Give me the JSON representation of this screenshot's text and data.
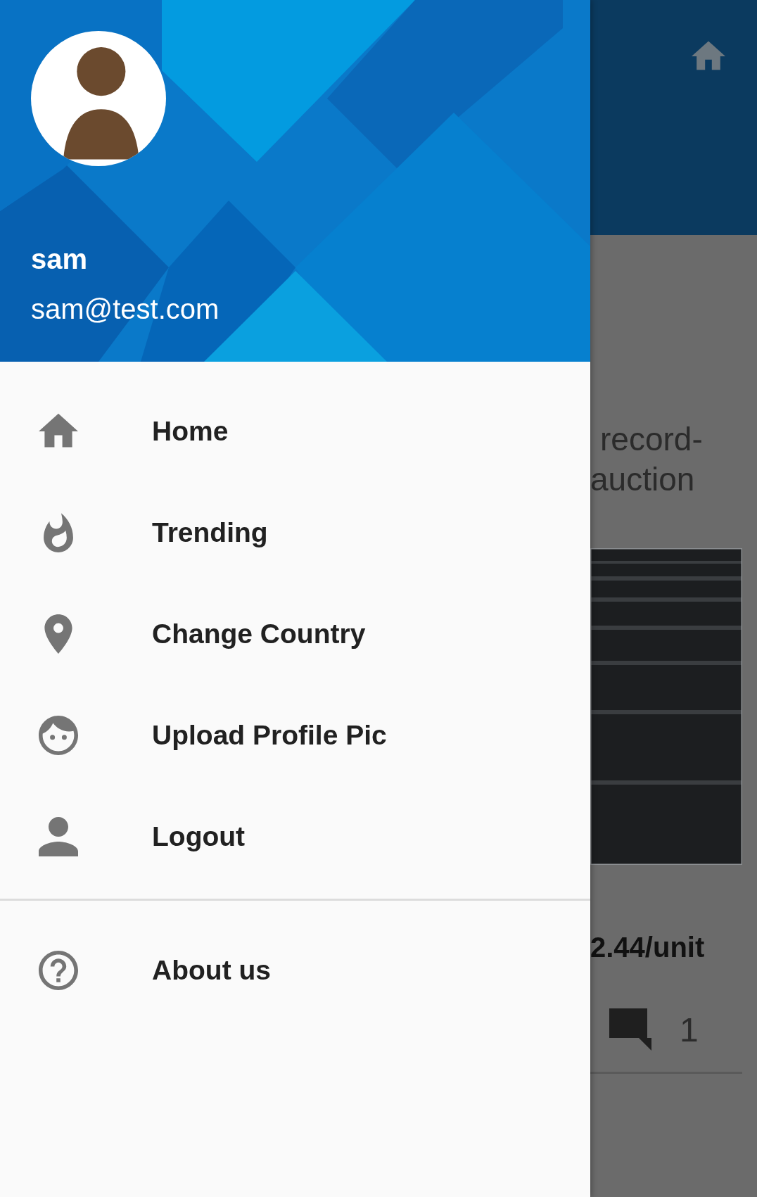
{
  "drawer": {
    "user": {
      "name": "sam",
      "email": "sam@test.com"
    },
    "menu": [
      {
        "label": "Home",
        "kind": "home"
      },
      {
        "label": "Trending",
        "kind": "flame"
      },
      {
        "label": "Change Country",
        "kind": "pin"
      },
      {
        "label": "Upload Profile Pic",
        "kind": "face"
      },
      {
        "label": "Logout",
        "kind": "person"
      }
    ],
    "secondary": [
      {
        "label": "About us",
        "kind": "help"
      }
    ]
  },
  "background": {
    "title_lines": [
      "record-",
      "auction"
    ],
    "price": "2.44/unit",
    "comment_count": "1"
  }
}
